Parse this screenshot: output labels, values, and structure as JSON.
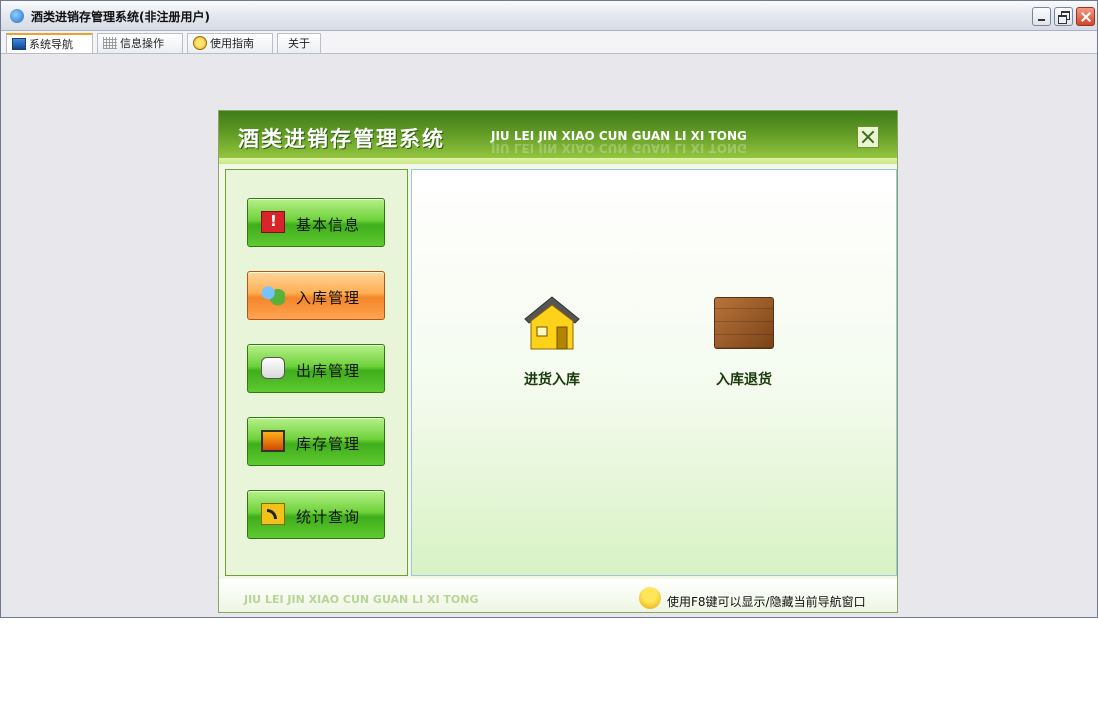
{
  "window": {
    "title": "酒类进销存管理系统(非注册用户)"
  },
  "tabs": [
    {
      "label": "系统导航",
      "icon": "monitor-icon",
      "active": true
    },
    {
      "label": "信息操作",
      "icon": "grid-icon",
      "active": false
    },
    {
      "label": "使用指南",
      "icon": "help-icon",
      "active": false
    },
    {
      "label": "关于",
      "icon": "",
      "active": false
    }
  ],
  "dialog": {
    "title_cn": "酒类进销存管理系统",
    "title_en": "JIU LEI JIN XIAO CUN GUAN LI XI TONG",
    "nav": [
      {
        "label": "基本信息",
        "icon": "alert-monitor-icon",
        "active": false
      },
      {
        "label": "入库管理",
        "icon": "users-icon",
        "active": true
      },
      {
        "label": "出库管理",
        "icon": "contact-card-icon",
        "active": false
      },
      {
        "label": "库存管理",
        "icon": "display-icon",
        "active": false
      },
      {
        "label": "统计查询",
        "icon": "rss-icon",
        "active": false
      }
    ],
    "functions": [
      {
        "label": "进货入库",
        "icon": "house-icon"
      },
      {
        "label": "入库退货",
        "icon": "crate-icon"
      }
    ],
    "footer_en": "JIU LEI JIN XIAO CUN GUAN LI XI TONG",
    "hint": "使用F8键可以显示/隐藏当前导航窗口"
  },
  "colors": {
    "accent_green": "#5f9a24",
    "active_orange": "#f3852a"
  }
}
